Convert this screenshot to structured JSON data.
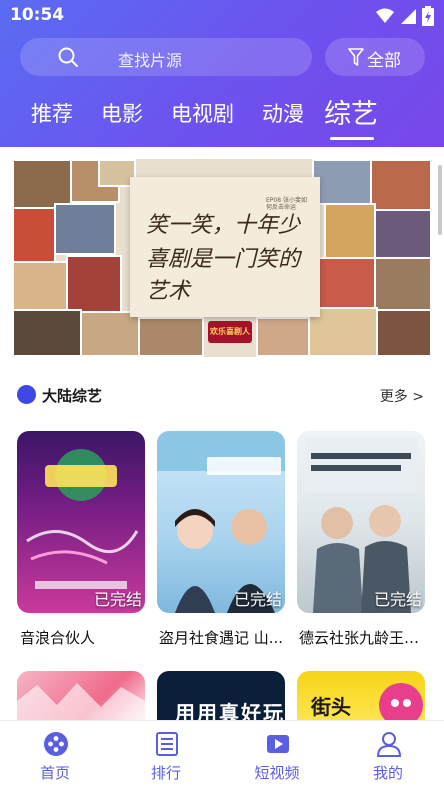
{
  "status": {
    "time": "10:54"
  },
  "search": {
    "placeholder": "查找片源"
  },
  "filter": {
    "label": "全部"
  },
  "tabs": [
    {
      "label": "推荐",
      "active": false
    },
    {
      "label": "电影",
      "active": false
    },
    {
      "label": "电视剧",
      "active": false
    },
    {
      "label": "动漫",
      "active": false
    },
    {
      "label": "综艺",
      "active": true
    }
  ],
  "banner": {
    "headline_line1": "笑一笑，十年少",
    "headline_line2": "喜剧是一门笑的艺术",
    "caption": "EP08 张小斐如何反击命运",
    "logo_text": "欢乐喜剧人"
  },
  "section": {
    "title": "大陆综艺",
    "more": "更多 >"
  },
  "posters": [
    {
      "title": "音浪合伙人",
      "badge": "已完结",
      "color_top": "#3b1566",
      "color_bottom": "#c93a9b"
    },
    {
      "title": "盗月社食遇记 山...",
      "badge": "已完结",
      "color_top": "#cfe8f7",
      "color_bottom": "#7fb8de"
    },
    {
      "title": "德云社张九龄王九...",
      "badge": "已完结",
      "color_top": "#f0f4f6",
      "color_bottom": "#bcc7cf"
    }
  ],
  "posters_row2": [
    {
      "color": "#f06a8a"
    },
    {
      "color": "#0c1f3a",
      "text": "用用真好玩"
    },
    {
      "color": "#f7d417",
      "text": "街头"
    }
  ],
  "bottom_nav": [
    {
      "label": "首页",
      "icon": "home-icon"
    },
    {
      "label": "排行",
      "icon": "ranking-icon"
    },
    {
      "label": "短视频",
      "icon": "short-video-icon"
    },
    {
      "label": "我的",
      "icon": "profile-icon"
    }
  ],
  "colors": {
    "accent": "#5a5fe0",
    "header_start": "#5a6cf2",
    "header_end": "#7847ea"
  }
}
